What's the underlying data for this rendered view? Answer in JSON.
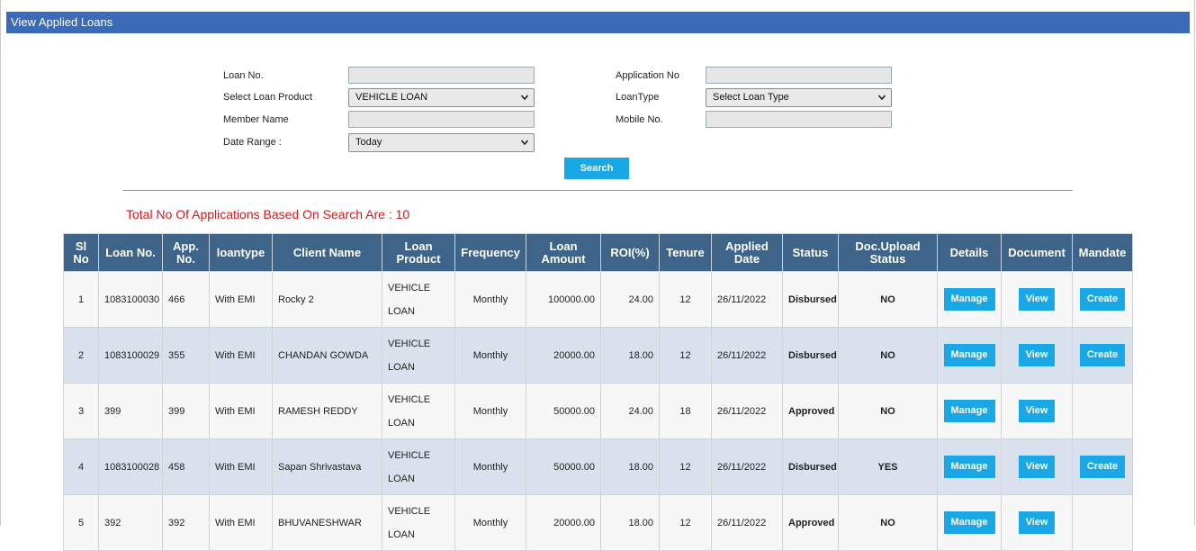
{
  "header": {
    "title": "View Applied Loans"
  },
  "filters": {
    "loan_no_label": "Loan No.",
    "loan_no_value": "",
    "application_no_label": "Application No",
    "application_no_value": "",
    "loan_product_label": "Select Loan Product",
    "loan_product_value": "VEHICLE LOAN",
    "loantype_label": "LoanType",
    "loantype_value": "Select Loan Type",
    "member_name_label": "Member Name",
    "member_name_value": "",
    "mobile_label": "Mobile No.",
    "mobile_value": "",
    "date_range_label": "Date Range :",
    "date_range_value": "Today",
    "search_label": "Search"
  },
  "summary": {
    "total_text": "Total No Of Applications Based On Search Are : 10"
  },
  "table": {
    "headers": {
      "sl": [
        "Sl",
        "No"
      ],
      "loan_no": "Loan No.",
      "app_no": [
        "App.",
        "No."
      ],
      "loantype": "loantype",
      "client": "Client Name",
      "product": [
        "Loan",
        "Product"
      ],
      "frequency": "Frequency",
      "amount": [
        "Loan",
        "Amount"
      ],
      "roi": "ROI(%)",
      "tenure": "Tenure",
      "applied": [
        "Applied",
        "Date"
      ],
      "status": "Status",
      "doc_status": [
        "Doc.Upload",
        "Status"
      ],
      "details": "Details",
      "document": "Document",
      "mandate": "Mandate"
    },
    "buttons": {
      "manage": "Manage",
      "view": "View",
      "create": "Create"
    },
    "rows": [
      {
        "sl": "1",
        "loan_no": "1083100030",
        "app_no": "466",
        "loantype": "With EMI",
        "client": "Rocky 2",
        "product_l1": "VEHICLE",
        "product_l2": "LOAN",
        "frequency": "Monthly",
        "amount": "100000.00",
        "roi": "24.00",
        "tenure": "12",
        "applied": "26/11/2022",
        "status": "Disbursed",
        "doc": "NO"
      },
      {
        "sl": "2",
        "loan_no": "1083100029",
        "app_no": "355",
        "loantype": "With EMI",
        "client": "CHANDAN GOWDA",
        "product_l1": "VEHICLE",
        "product_l2": "LOAN",
        "frequency": "Monthly",
        "amount": "20000.00",
        "roi": "18.00",
        "tenure": "12",
        "applied": "26/11/2022",
        "status": "Disbursed",
        "doc": "NO"
      },
      {
        "sl": "3",
        "loan_no": "399",
        "app_no": "399",
        "loantype": "With EMI",
        "client": "RAMESH REDDY",
        "product_l1": "VEHICLE",
        "product_l2": "LOAN",
        "frequency": "Monthly",
        "amount": "50000.00",
        "roi": "24.00",
        "tenure": "18",
        "applied": "26/11/2022",
        "status": "Approved",
        "doc": "NO"
      },
      {
        "sl": "4",
        "loan_no": "1083100028",
        "app_no": "458",
        "loantype": "With EMI",
        "client": "Sapan Shrivastava",
        "product_l1": "VEHICLE",
        "product_l2": "LOAN",
        "frequency": "Monthly",
        "amount": "50000.00",
        "roi": "18.00",
        "tenure": "12",
        "applied": "26/11/2022",
        "status": "Disbursed",
        "doc": "YES"
      },
      {
        "sl": "5",
        "loan_no": "392",
        "app_no": "392",
        "loantype": "With EMI",
        "client": "BHUVANESHWAR",
        "product_l1": "VEHICLE",
        "product_l2": "LOAN",
        "frequency": "Monthly",
        "amount": "20000.00",
        "roi": "18.00",
        "tenure": "12",
        "applied": "26/11/2022",
        "status": "Approved",
        "doc": "NO"
      }
    ]
  },
  "colors": {
    "header_bar": "#3a6ab8",
    "table_header": "#3e6489",
    "button": "#1aa7e6",
    "status_disbursed": "#1a7a1a",
    "status_approved": "#d11a1a",
    "total_text": "#d11a1a"
  }
}
